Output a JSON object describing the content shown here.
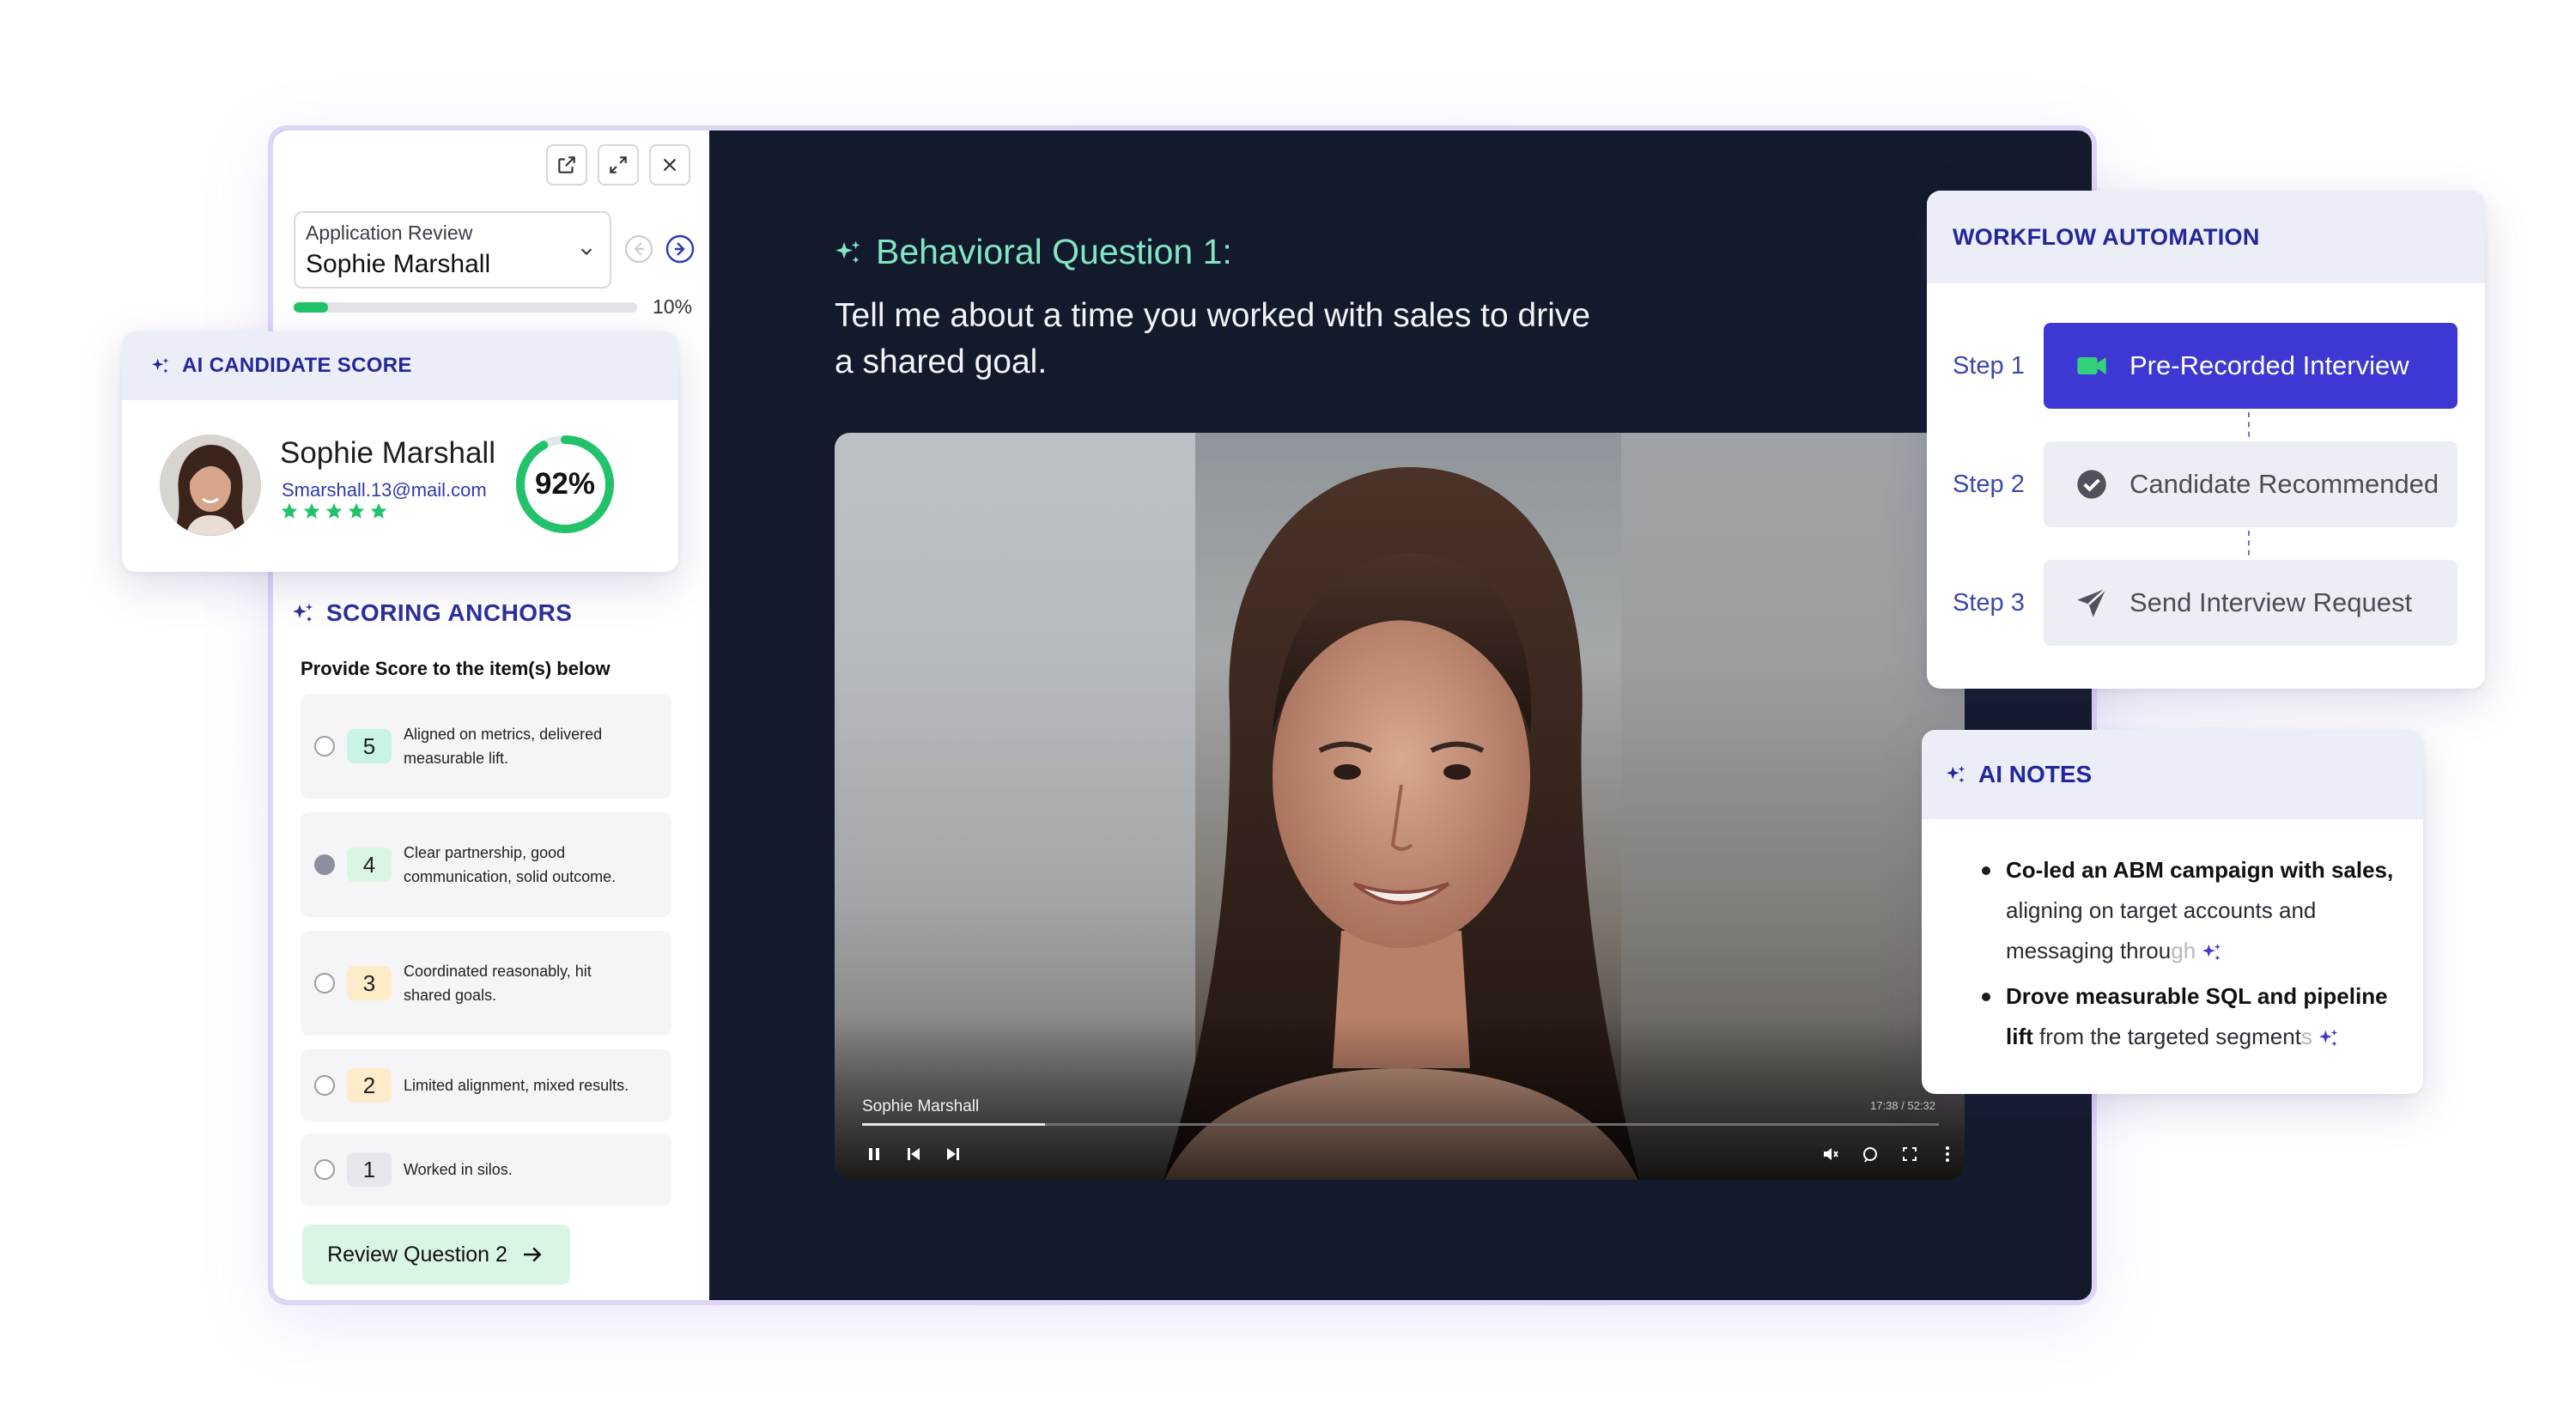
{
  "colors": {
    "accent": "#3d37d3",
    "navy_text": "#22279a",
    "success": "#22c26a",
    "question_title": "#82e5c4",
    "video_bg": "#131a2b"
  },
  "window_controls": [
    "external-link-icon",
    "expand-icon",
    "close-icon"
  ],
  "application": {
    "label": "Application Review",
    "value": "Sophie Marshall",
    "progress": 0.1,
    "progress_text": "10%"
  },
  "score_card": {
    "title": "AI CANDIDATE SCORE",
    "name": "Sophie Marshall",
    "email": "Smarshall.13@mail.com",
    "stars": 5,
    "score": 0.92,
    "score_text": "92%"
  },
  "scoring": {
    "title": "SCORING ANCHORS",
    "subtitle": "Provide Score to the item(s) below",
    "anchors": [
      {
        "score": "5",
        "text": "Aligned on metrics, delivered measurable lift.",
        "selected": false,
        "color": "#c9f3e6"
      },
      {
        "score": "4",
        "text": "Clear partnership, good communication, solid outcome.",
        "selected": true,
        "color": "#daf5e4"
      },
      {
        "score": "3",
        "text": "Coordinated reasonably, hit shared goals.",
        "selected": false,
        "color": "#fdecc8"
      },
      {
        "score": "2",
        "text": "Limited alignment, mixed results.",
        "selected": false,
        "color": "#fdebc9"
      },
      {
        "score": "1",
        "text": "Worked in silos.",
        "selected": false,
        "color": "#e6e7ec"
      }
    ],
    "review_button": "Review Question 2"
  },
  "question": {
    "title": "Behavioral Question 1:",
    "text": "Tell me about a time you worked with sales to drive a shared goal."
  },
  "video": {
    "speaker": "Sophie Marshall",
    "time": "17:38 / 52:32",
    "played": 0.17
  },
  "workflow": {
    "title": "WORKFLOW AUTOMATION",
    "steps": [
      {
        "label": "Step 1",
        "name": "Pre-Recorded Interview",
        "icon": "video-camera-icon",
        "active": true
      },
      {
        "label": "Step 2",
        "name": "Candidate Recommended",
        "icon": "check-circle-icon",
        "active": false
      },
      {
        "label": "Step 3",
        "name": "Send Interview Request",
        "icon": "send-icon",
        "active": false
      }
    ]
  },
  "notes": {
    "title": "AI NOTES",
    "items": [
      {
        "bold": "Co-led an ABM campaign with sales,",
        "rest": " aligning on target accounts and messaging throu",
        "fade": "gh"
      },
      {
        "bold": "Drove measurable SQL and pipeline lift",
        "rest": " from the targeted segment",
        "fade": "s"
      }
    ]
  }
}
